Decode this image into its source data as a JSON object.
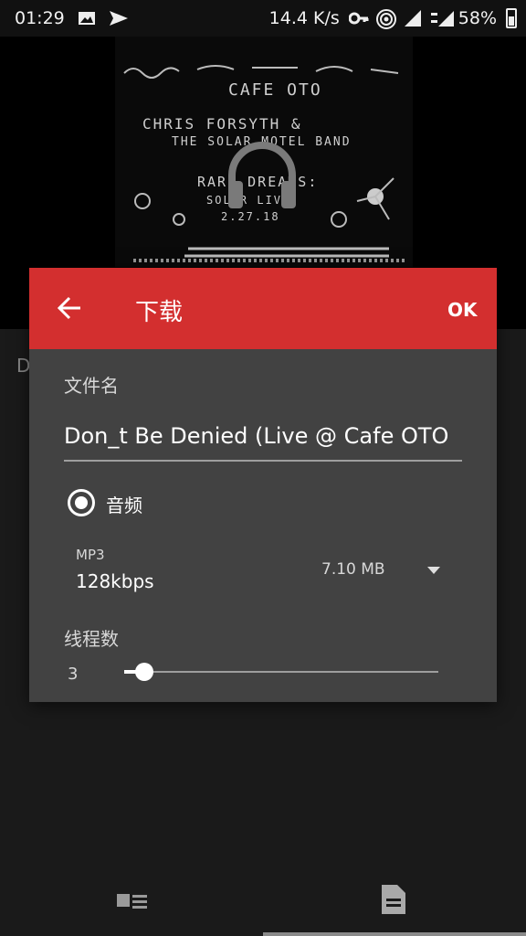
{
  "status_bar": {
    "time": "01:29",
    "network_speed": "14.4 K/s",
    "battery": "58%"
  },
  "album": {
    "lines": [
      "CAFE OTO",
      "CHRIS FORSYTH &",
      "THE SOLAR MOTEL BAND",
      "RARE DREAMS:",
      "SOLAR LIVE",
      "2.27.18"
    ]
  },
  "background": {
    "partial_text": "D"
  },
  "dialog": {
    "title": "下载",
    "ok_label": "OK",
    "filename_label": "文件名",
    "filename_value": "Don_t Be Denied (Live @ Cafe OTO",
    "audio_option_label": "音频",
    "format": "MP3",
    "bitrate": "128kbps",
    "size": "7.10 MB",
    "threads_label": "线程数",
    "threads_value": "3",
    "threads_level_fraction": 0.05
  },
  "colors": {
    "header": "#d32f2f",
    "dialog_bg": "#424242"
  }
}
